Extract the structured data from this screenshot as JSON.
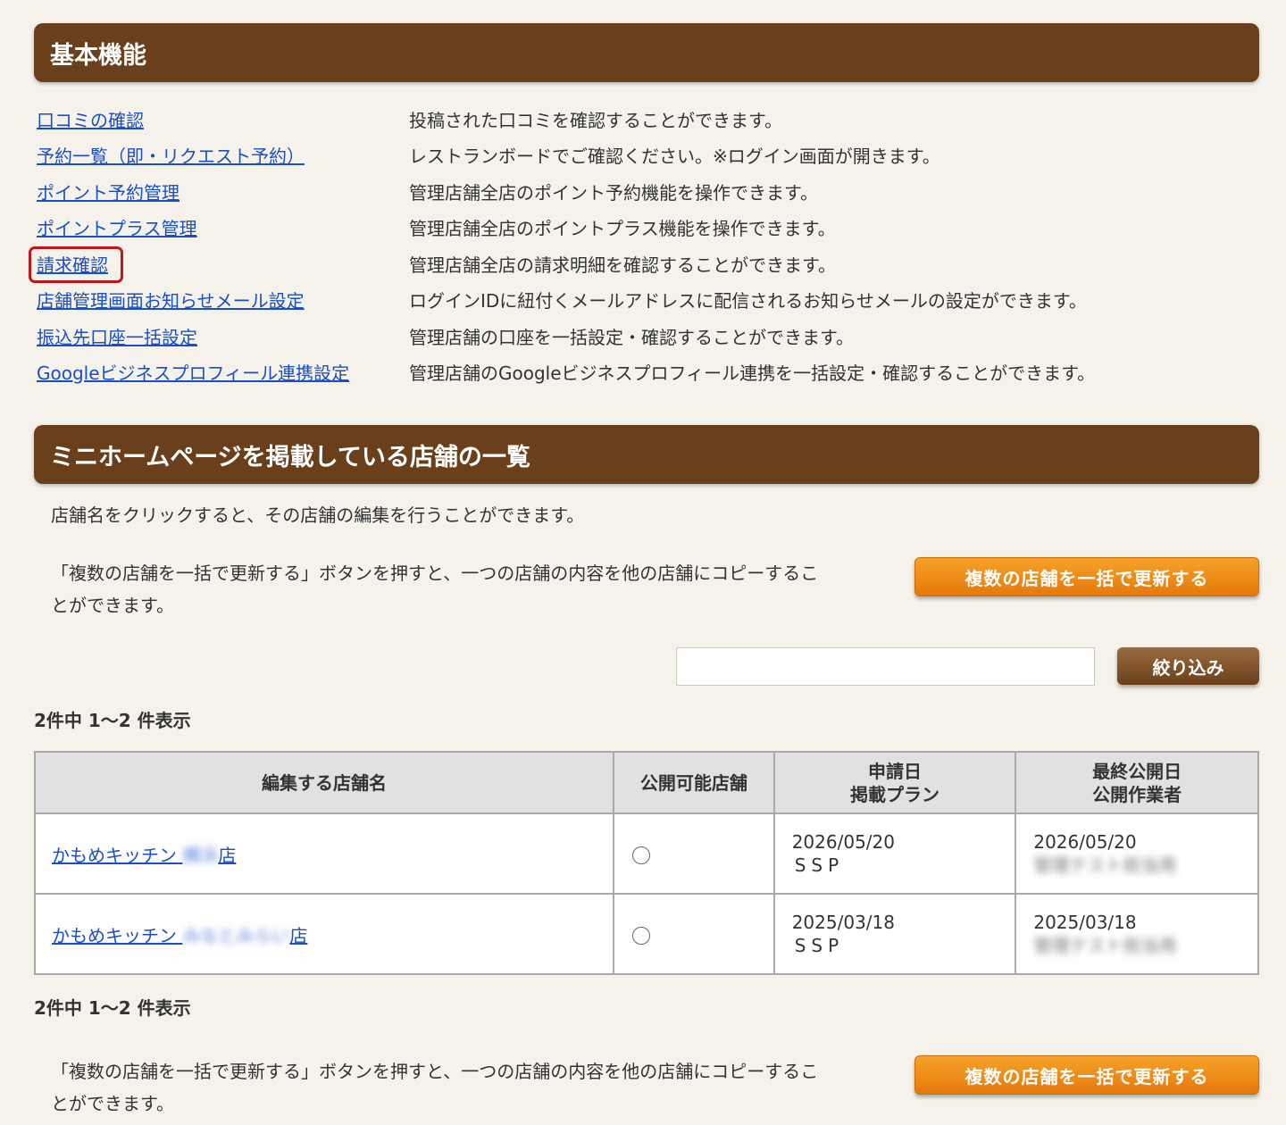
{
  "basic": {
    "title": "基本機能",
    "items": [
      {
        "link": "口コミの確認",
        "desc": "投稿された口コミを確認することができます。"
      },
      {
        "link": "予約一覧（即・リクエスト予約）",
        "desc": "レストランボードでご確認ください。※ログイン画面が開きます。"
      },
      {
        "link": "ポイント予約管理",
        "desc": "管理店舗全店のポイント予約機能を操作できます。"
      },
      {
        "link": "ポイントプラス管理",
        "desc": "管理店舗全店のポイントプラス機能を操作できます。"
      },
      {
        "link": "請求確認",
        "desc": "管理店舗全店の請求明細を確認することができます。"
      },
      {
        "link": "店舗管理画面お知らせメール設定",
        "desc": "ログインIDに紐付くメールアドレスに配信されるお知らせメールの設定ができます。"
      },
      {
        "link": "振込先口座一括設定",
        "desc": "管理店舗の口座を一括設定・確認することができます。"
      },
      {
        "link": "Googleビジネスプロフィール連携設定",
        "desc": "管理店舗のGoogleビジネスプロフィール連携を一括設定・確認することができます。"
      }
    ]
  },
  "mini": {
    "title": "ミニホームページを掲載している店舗の一覧",
    "intro": "店舗名をクリックすると、その店舗の編集を行うことができます。",
    "bulk_note_line1": "「複数の店舗を一括で更新する」ボタンを押すと、一つの店舗の内容を他の店舗にコピーするこ",
    "bulk_note_line2": "とができます。",
    "bulk_button": "複数の店舗を一括で更新する",
    "search_value": "",
    "filter_button": "絞り込み",
    "count_text": "2件中 1〜2 件表示",
    "table": {
      "headers": {
        "store_name": "編集する店舗名",
        "publishable": "公開可能店舗",
        "apply_date": "申請日",
        "plan": "掲載プラン",
        "last_published": "最終公開日",
        "operator": "公開作業者"
      },
      "rows": [
        {
          "name_prefix": "かもめキッチン ",
          "name_blurred": "横浜",
          "name_suffix": "店",
          "apply_date": "2026/05/20",
          "plan": "SSP",
          "last_published": "2026/05/20",
          "operator_blurred": "管理テスト担当用"
        },
        {
          "name_prefix": "かもめキッチン ",
          "name_blurred": "みなとみらい",
          "name_suffix": "店",
          "apply_date": "2025/03/18",
          "plan": "SSP",
          "last_published": "2025/03/18",
          "operator_blurred": "管理テスト担当用"
        }
      ]
    }
  },
  "colors": {
    "header_brown": "#6a3f1b",
    "link_blue": "#1a4fc4",
    "orange_button": "#f18a1a",
    "highlight_red": "#c0151a"
  }
}
